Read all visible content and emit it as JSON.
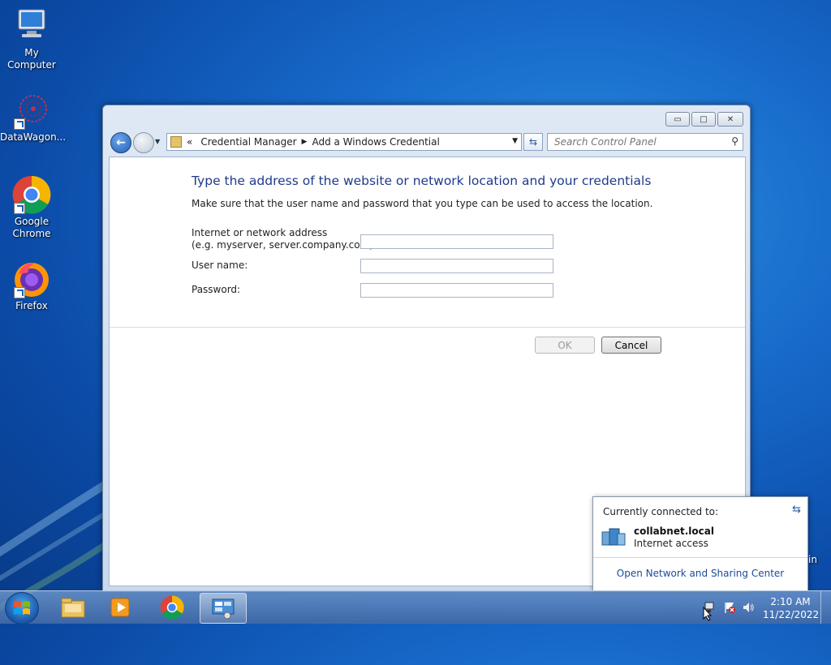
{
  "desktop": {
    "icons": [
      {
        "label": "My Computer"
      },
      {
        "label": "DataWagon..."
      },
      {
        "label": "Google Chrome"
      },
      {
        "label": "Firefox"
      }
    ],
    "edge_text": "in"
  },
  "window": {
    "breadcrumb": {
      "prefix": "«",
      "items": [
        "Credential Manager",
        "Add a Windows Credential"
      ]
    },
    "search_placeholder": "Search Control Panel",
    "heading": "Type the address of the website or network location and your credentials",
    "subtext": "Make sure that the user name and password that you type can be used to access the location.",
    "form": {
      "address_label_1": "Internet or network address",
      "address_label_2": "(e.g. myserver, server.company.com):",
      "address_value": "",
      "username_label": "User name:",
      "username_value": "",
      "password_label": "Password:",
      "password_value": ""
    },
    "buttons": {
      "ok": "OK",
      "cancel": "Cancel"
    }
  },
  "network_flyout": {
    "title": "Currently connected to:",
    "network_name": "collabnet.local",
    "network_status": "Internet access",
    "link": "Open Network and Sharing Center"
  },
  "taskbar": {
    "clock_time": "2:10 AM",
    "clock_date": "11/22/2022"
  }
}
